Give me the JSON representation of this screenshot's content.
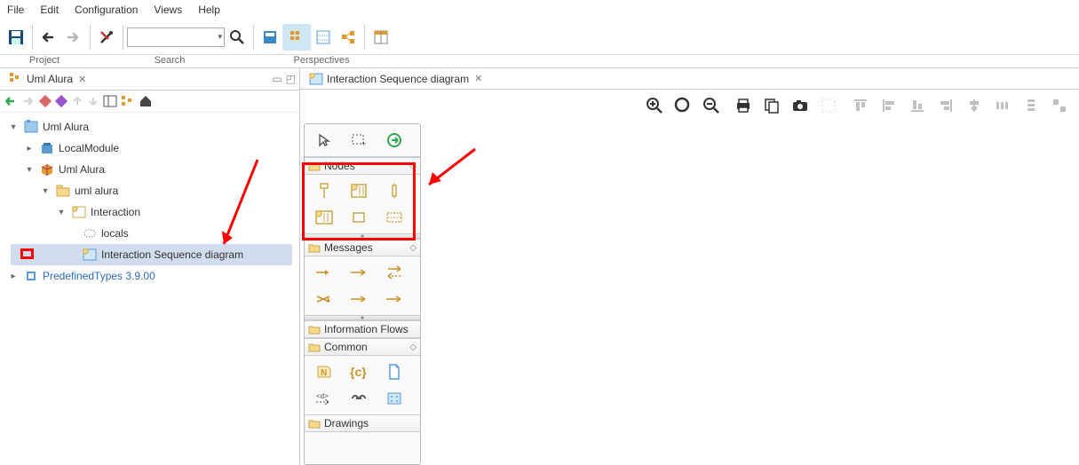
{
  "menu": {
    "items": [
      "File",
      "Edit",
      "Configuration",
      "Views",
      "Help"
    ]
  },
  "toolbar_groups": {
    "project": "Project",
    "search": "Search",
    "perspectives": "Perspectives"
  },
  "left": {
    "tab": "Uml Alura",
    "tree": {
      "root": "Uml Alura",
      "localModule": "LocalModule",
      "umlAlura2": "Uml Alura",
      "umlAluraPkg": "uml alura",
      "interaction": "Interaction",
      "locals": "locals",
      "diagram": "Interaction Sequence diagram",
      "predefined": "PredefinedTypes 3.9.00"
    }
  },
  "editor": {
    "tab": "Interaction Sequence diagram"
  },
  "palette": {
    "nodes": "Nodes",
    "messages": "Messages",
    "infoFlows": "Information Flows",
    "common": "Common",
    "drawings": "Drawings"
  }
}
